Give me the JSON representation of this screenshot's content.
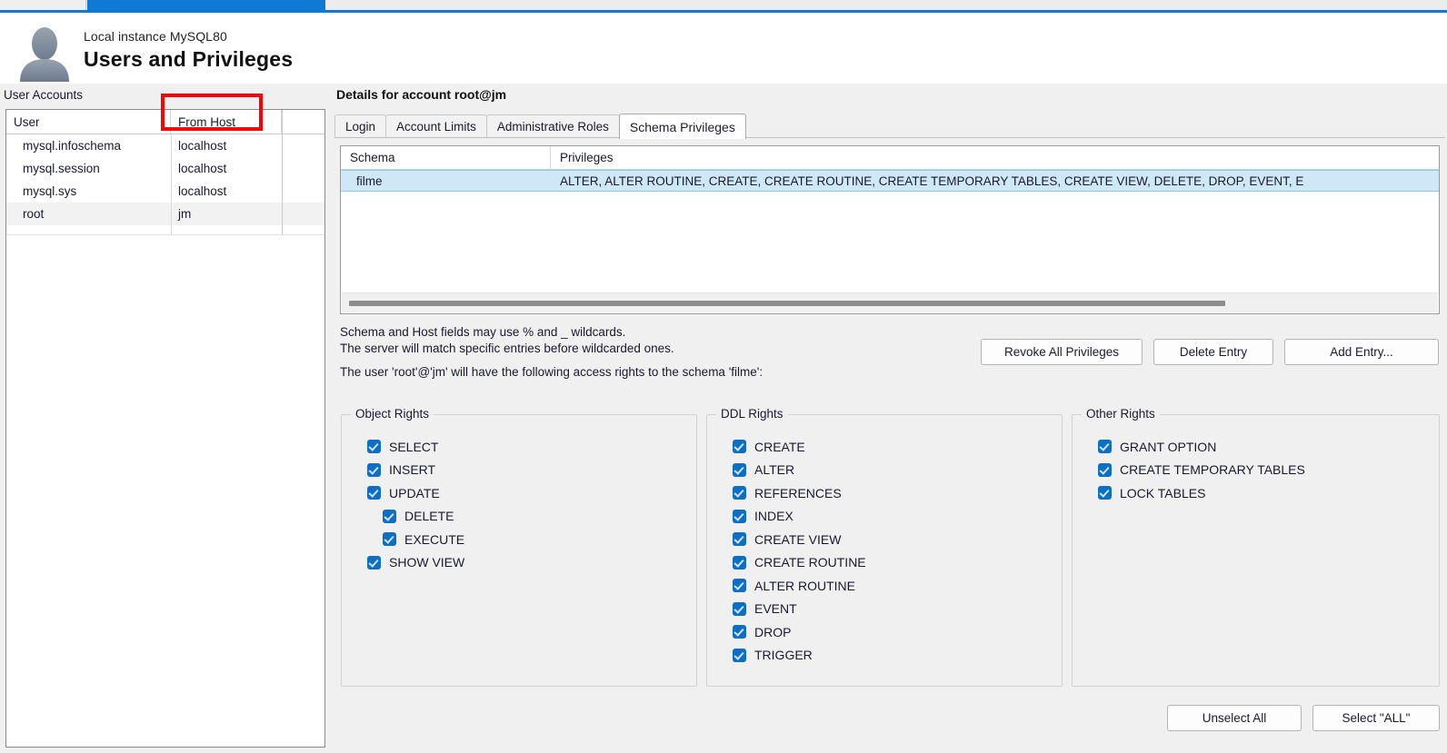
{
  "window": {
    "instance_label": "Local instance MySQL80",
    "page_title": "Users and Privileges"
  },
  "left_panel": {
    "label": "User Accounts",
    "columns": [
      "User",
      "From Host",
      ""
    ],
    "rows": [
      {
        "user": "mysql.infoschema",
        "host": "localhost"
      },
      {
        "user": "mysql.session",
        "host": "localhost"
      },
      {
        "user": "mysql.sys",
        "host": "localhost"
      },
      {
        "user": "root",
        "host": "jm"
      }
    ],
    "selected_index": 3,
    "highlight_color": "#ff0000"
  },
  "details": {
    "title": "Details for account root@jm",
    "tabs": [
      {
        "label": "Login",
        "active": false
      },
      {
        "label": "Account Limits",
        "active": false
      },
      {
        "label": "Administrative Roles",
        "active": false
      },
      {
        "label": "Schema Privileges",
        "active": true
      }
    ]
  },
  "privileges_grid": {
    "columns": [
      "Schema",
      "Privileges"
    ],
    "rows": [
      {
        "schema": "filme",
        "privileges": "ALTER, ALTER ROUTINE, CREATE, CREATE ROUTINE, CREATE TEMPORARY TABLES, CREATE VIEW, DELETE, DROP, EVENT, E"
      }
    ]
  },
  "help": {
    "line1": "Schema and Host fields may use % and _ wildcards.",
    "line2": "The server will match specific entries before wildcarded ones.",
    "line3": "The user 'root'@'jm' will have the following access rights to the schema 'filme':"
  },
  "actions": {
    "revoke_all": "Revoke All Privileges",
    "delete_entry": "Delete Entry",
    "add_entry": "Add Entry...",
    "unselect_all": "Unselect All",
    "select_all": "Select \"ALL\""
  },
  "rights": {
    "object": {
      "legend": "Object Rights",
      "items": [
        {
          "label": "SELECT",
          "checked": true,
          "indent": false
        },
        {
          "label": "INSERT",
          "checked": true,
          "indent": false
        },
        {
          "label": "UPDATE",
          "checked": true,
          "indent": false
        },
        {
          "label": "DELETE",
          "checked": true,
          "indent": true
        },
        {
          "label": "EXECUTE",
          "checked": true,
          "indent": true
        },
        {
          "label": "SHOW VIEW",
          "checked": true,
          "indent": false
        }
      ]
    },
    "ddl": {
      "legend": "DDL Rights",
      "items": [
        {
          "label": "CREATE",
          "checked": true,
          "indent": false
        },
        {
          "label": "ALTER",
          "checked": true,
          "indent": false
        },
        {
          "label": "REFERENCES",
          "checked": true,
          "indent": false
        },
        {
          "label": "INDEX",
          "checked": true,
          "indent": false
        },
        {
          "label": "CREATE VIEW",
          "checked": true,
          "indent": false
        },
        {
          "label": "CREATE ROUTINE",
          "checked": true,
          "indent": false
        },
        {
          "label": "ALTER ROUTINE",
          "checked": true,
          "indent": false
        },
        {
          "label": "EVENT",
          "checked": true,
          "indent": false
        },
        {
          "label": "DROP",
          "checked": true,
          "indent": false
        },
        {
          "label": "TRIGGER",
          "checked": true,
          "indent": false
        }
      ]
    },
    "other": {
      "legend": "Other Rights",
      "items": [
        {
          "label": "GRANT OPTION",
          "checked": true,
          "indent": false
        },
        {
          "label": "CREATE TEMPORARY TABLES",
          "checked": true,
          "indent": false
        },
        {
          "label": "LOCK TABLES",
          "checked": true,
          "indent": false
        }
      ]
    }
  },
  "theme": {
    "accent": "#0e7ad4",
    "checkbox": "#0d6ec4",
    "selection": "#cfe8f8"
  }
}
